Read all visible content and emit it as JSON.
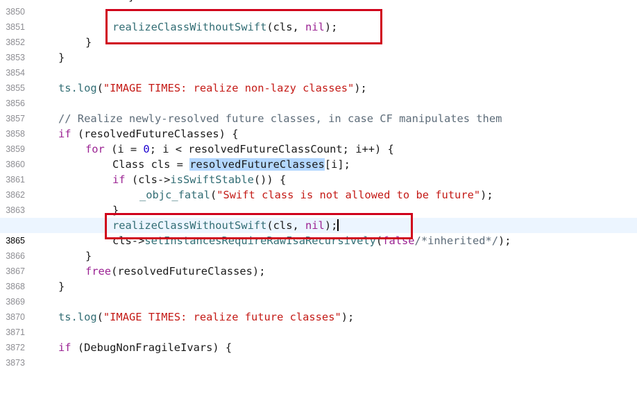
{
  "gutter": {
    "top_partial": "3850",
    "lines": [
      "3851",
      "3852",
      "3853",
      "3854",
      "3855",
      "3856",
      "3857",
      "3858",
      "3859",
      "3860",
      "3861",
      "3862",
      "3863",
      "3864",
      "3865",
      "3866",
      "3867",
      "3868",
      "3869",
      "3870",
      "3871",
      "3872",
      "3873"
    ]
  },
  "current_line": "3865",
  "code": {
    "l3852": {
      "fn": "realizeClassWithoutSwift",
      "p1": "(cls, ",
      "kw": "nil",
      "p2": ");"
    },
    "l3853": "}",
    "l3854": "}",
    "l3856": {
      "fn": "ts.log",
      "p1": "(",
      "str": "\"IMAGE TIMES: realize non-lazy classes\"",
      "p2": ");"
    },
    "l3858": "// Realize newly-resolved future classes, in case CF manipulates them",
    "l3859": {
      "kw": "if",
      "rest": " (resolvedFutureClasses) {"
    },
    "l3860": {
      "kw": "for",
      "p1": " (i = ",
      "num": "0",
      "p2": "; i < resolvedFutureClassCount; i++) {"
    },
    "l3861": {
      "t1": "Class cls = ",
      "sel": "resolvedFutureClasses",
      "t2": "[i];"
    },
    "l3862": {
      "kw": "if",
      "p1": " (cls->",
      "fn": "isSwiftStable",
      "p2": "()) {"
    },
    "l3863": {
      "fn": "_objc_fatal",
      "p1": "(",
      "str": "\"Swift class is not allowed to be future\"",
      "p2": ");"
    },
    "l3864": "}",
    "l3865": {
      "fn": "realizeClassWithoutSwift",
      "p1": "(cls, ",
      "kw": "nil",
      "p2": ");"
    },
    "l3866": {
      "t1": "cls->",
      "fn": "setInstancesRequireRawIsaRecursively",
      "p1": "(",
      "kw": "false",
      "cm": "/*inherited*/",
      "p2": ");"
    },
    "l3867": "}",
    "l3868": {
      "fn": "free",
      "rest": "(resolvedFutureClasses);"
    },
    "l3869": "}",
    "l3871": {
      "fn": "ts.log",
      "p1": "(",
      "str": "\"IMAGE TIMES: realize future classes\"",
      "p2": ");"
    },
    "l3873": {
      "kw": "if",
      "rest": " (DebugNonFragileIvars) {"
    }
  },
  "colors": {
    "keyword": "#9b2393",
    "function": "#326d74",
    "string": "#c41a16",
    "comment": "#5d6c79",
    "selection": "#b3d7ff",
    "highlight_box": "#d0021b",
    "current_line_bg": "#ecf5ff"
  }
}
